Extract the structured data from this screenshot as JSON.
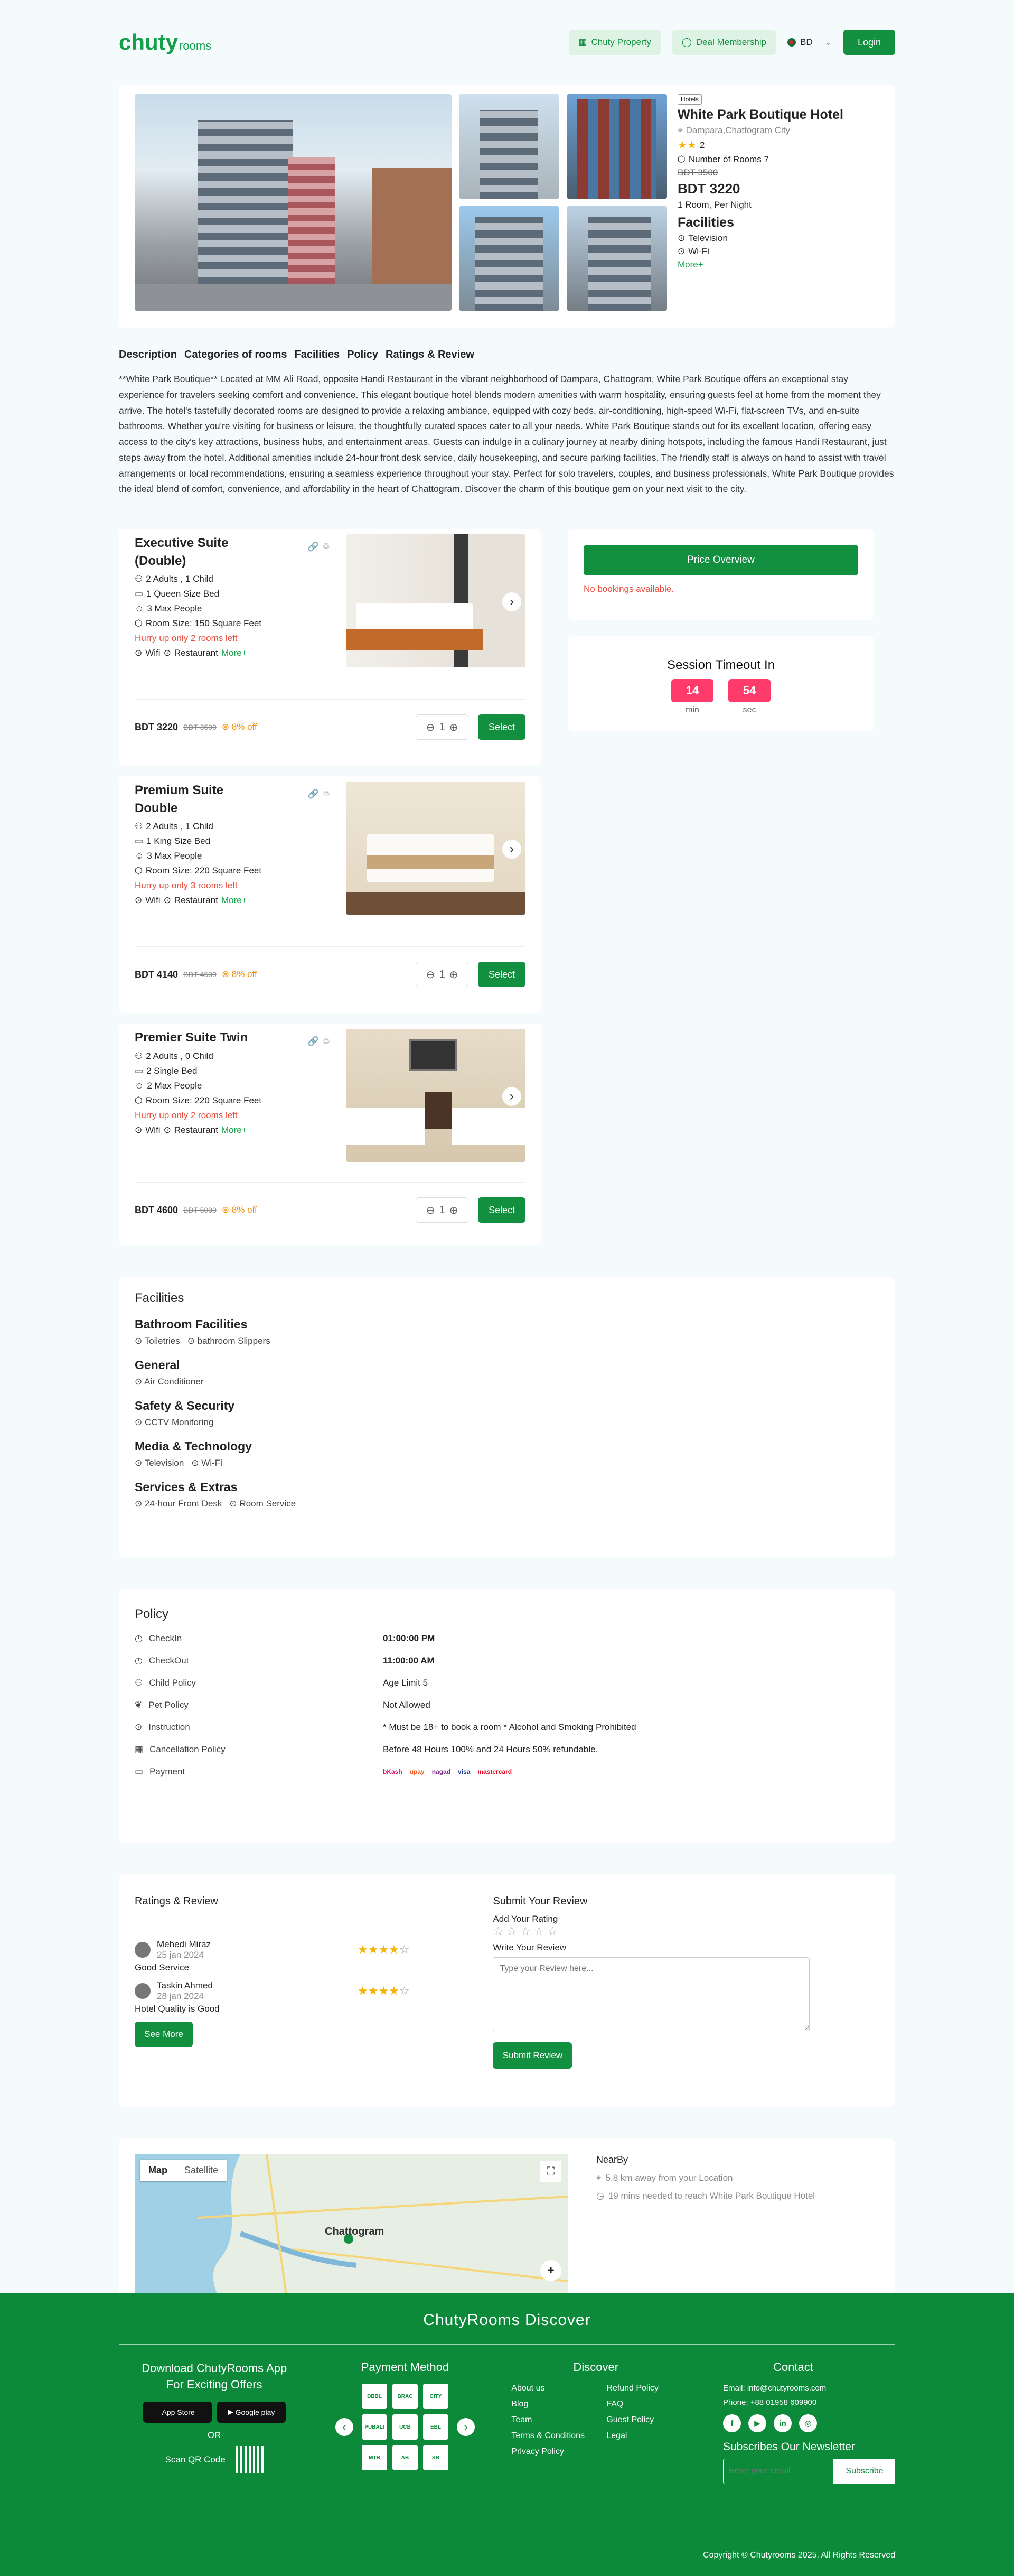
{
  "header": {
    "logo_main": "chuty",
    "logo_sub": "rooms",
    "property_label": "Chuty Property",
    "deal_label": "Deal Membership",
    "lang": "BD",
    "login_label": "Login"
  },
  "hotel": {
    "tag": "Hotels",
    "name": "White Park Boutique Hotel",
    "location": "Dampara,Chattogram City",
    "rating": "2",
    "rooms_count": "Number of Rooms 7",
    "old_price": "BDT 3500",
    "price": "BDT 3220",
    "price_note": "1 Room, Per Night",
    "facilities_title": "Facilities",
    "facility_1": "Television",
    "facility_2": "Wi-Fi",
    "more": "More+"
  },
  "tabs": [
    "Description",
    "Categories of rooms",
    "Facilities",
    "Policy",
    "Ratings & Review"
  ],
  "description": "**White Park Boutique** Located at MM Ali Road, opposite Handi Restaurant in the vibrant neighborhood of Dampara, Chattogram, White Park Boutique offers an exceptional stay experience for travelers seeking comfort and convenience. This elegant boutique hotel blends modern amenities with warm hospitality, ensuring guests feel at home from the moment they arrive. The hotel's tastefully decorated rooms are designed to provide a relaxing ambiance, equipped with cozy beds, air-conditioning, high-speed Wi-Fi, flat-screen TVs, and en-suite bathrooms. Whether you're visiting for business or leisure, the thoughtfully curated spaces cater to all your needs. White Park Boutique stands out for its excellent location, offering easy access to the city's key attractions, business hubs, and entertainment areas. Guests can indulge in a culinary journey at nearby dining hotspots, including the famous Handi Restaurant, just steps away from the hotel. Additional amenities include 24-hour front desk service, daily housekeeping, and secure parking facilities. The friendly staff is always on hand to assist with travel arrangements or local recommendations, ensuring a seamless experience throughout your stay. Perfect for solo travelers, couples, and business professionals, White Park Boutique provides the ideal blend of comfort, convenience, and affordability in the heart of Chattogram. Discover the charm of this boutique gem on your next visit to the city.",
  "rooms": [
    {
      "name": "Executive Suite (Double)",
      "guests": "2 Adults , 1 Child",
      "bed": "1 Queen Size Bed",
      "max": "3 Max People",
      "size": "Room Size: 150 Square Feet",
      "hurry": "Hurry up only 2 rooms left",
      "amen1": "Wifi",
      "amen2": "Restaurant",
      "more": "More+",
      "price": "BDT 3220",
      "old": "BDT 3500",
      "off": "8% off",
      "qty": "1",
      "select": "Select"
    },
    {
      "name": "Premium Suite Double",
      "guests": "2 Adults , 1 Child",
      "bed": "1 King Size Bed",
      "max": "3 Max People",
      "size": "Room Size: 220 Square Feet",
      "hurry": "Hurry up only 3 rooms left",
      "amen1": "Wifi",
      "amen2": "Restaurant",
      "more": "More+",
      "price": "BDT 4140",
      "old": "BDT 4500",
      "off": "8% off",
      "qty": "1",
      "select": "Select"
    },
    {
      "name": "Premier Suite Twin",
      "guests": "2 Adults , 0 Child",
      "bed": "2 Single Bed",
      "max": "2 Max People",
      "size": "Room Size: 220 Square Feet",
      "hurry": "Hurry up only 2 rooms left",
      "amen1": "Wifi",
      "amen2": "Restaurant",
      "more": "More+",
      "price": "BDT 4600",
      "old": "BDT 5000",
      "off": "8% off",
      "qty": "1",
      "select": "Select"
    }
  ],
  "sidebar": {
    "price_overview": "Price Overview",
    "no_bookings": "No bookings available.",
    "timeout_title": "Session Timeout In",
    "minutes": "14",
    "seconds": "54",
    "min_label": "min",
    "sec_label": "sec"
  },
  "facilities": {
    "title": "Facilities",
    "groups": [
      {
        "name": "Bathroom Facilities",
        "items": [
          "Toiletries",
          "bathroom Slippers"
        ]
      },
      {
        "name": "General",
        "items": [
          "Air Conditioner"
        ]
      },
      {
        "name": "Safety & Security",
        "items": [
          "CCTV Monitoring"
        ]
      },
      {
        "name": "Media & Technology",
        "items": [
          "Television",
          "Wi-Fi"
        ]
      },
      {
        "name": "Services & Extras",
        "items": [
          "24-hour Front Desk",
          "Room Service"
        ]
      }
    ]
  },
  "policy": {
    "title": "Policy",
    "rows": [
      {
        "label": "CheckIn",
        "value": "01:00:00 PM"
      },
      {
        "label": "CheckOut",
        "value": "11:00:00 AM"
      },
      {
        "label": "Child Policy",
        "value": "Age Limit 5"
      },
      {
        "label": "Pet Policy",
        "value": "Not Allowed"
      },
      {
        "label": "Instruction",
        "value": "* Must be 18+ to book a room * Alcohol and Smoking Prohibited"
      },
      {
        "label": "Cancellation Policy",
        "value": "Before 48 Hours 100% and 24 Hours 50% refundable."
      },
      {
        "label": "Payment",
        "value": ""
      }
    ],
    "pay_logos": [
      "bKash",
      "upay",
      "nagad",
      "visa",
      "mastercard"
    ]
  },
  "reviews": {
    "title": "Ratings & Review",
    "items": [
      {
        "name": "Mehedi Miraz",
        "date": "25 jan 2024",
        "text": "Good Service"
      },
      {
        "name": "Taskin Ahmed",
        "date": "28 jan 2024",
        "text": "Hotel Quality is Good"
      }
    ],
    "see_more": "See More",
    "submit_title": "Submit Your Review",
    "add_rating": "Add Your Rating",
    "write_review": "Write Your Review",
    "placeholder": "Type your Review here...",
    "submit_btn": "Submit Review"
  },
  "map": {
    "tab_map": "Map",
    "tab_sat": "Satellite",
    "place": "Chattogram",
    "nearby_title": "NearBy",
    "near1": "5.8 km away from your Location",
    "near2": "19 mins needed to reach White Park Boutique Hotel"
  },
  "footer": {
    "title": "ChutyRooms Discover",
    "download_title": "Download ChutyRooms App For Exciting Offers",
    "app_store": "App Store",
    "google_play": "Google play",
    "or": "OR",
    "scan": "Scan QR Code",
    "payment_title": "Payment Method",
    "discover_title": "Discover",
    "links": [
      "About us",
      "Refund Policy",
      "Blog",
      "FAQ",
      "Team",
      "Guest Policy",
      "Terms & Conditions",
      "Legal",
      "Privacy Policy"
    ],
    "contact_title": "Contact",
    "email": "Email: info@chutyrooms.com",
    "phone": "Phone: +88 01958 609900",
    "newsletter": "Subscribes Our Newsletter",
    "email_placeholder": "Enter your email",
    "subscribe": "Subscribe",
    "copyright": "Copyright © Chutyrooms 2025. All Rights Reserved"
  }
}
